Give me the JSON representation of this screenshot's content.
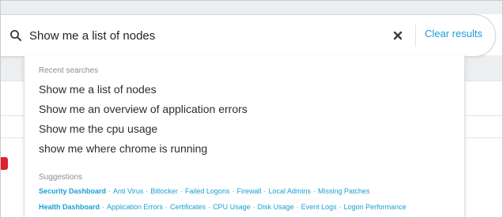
{
  "search": {
    "query": "Show me a list of nodes",
    "clear_label": "Clear results"
  },
  "dropdown": {
    "recent_heading": "Recent searches",
    "recent": [
      "Show me a list of nodes",
      "Show me an overview of application errors",
      "Show me the cpu usage",
      "show me where chrome is running"
    ],
    "suggestions_heading": "Suggestions",
    "suggestion_rows": [
      {
        "heading": "Security Dashboard",
        "links": [
          "Anti Virus",
          "Bitlocker",
          "Failed Logons",
          "Firewall",
          "Local Admins",
          "Missing Patches"
        ]
      },
      {
        "heading": "Health Dashboard",
        "links": [
          "Application Errors",
          "Certificates",
          "CPU Usage",
          "Disk Usage",
          "Event Logs",
          "Logon Performance"
        ]
      }
    ],
    "separator": "·"
  },
  "colors": {
    "accent": "#1a9fd6",
    "badge": "#e0202a",
    "text": "#2b2d31",
    "muted": "#8a8e94"
  },
  "icons": {
    "search": "search-icon",
    "clear": "close-icon"
  }
}
